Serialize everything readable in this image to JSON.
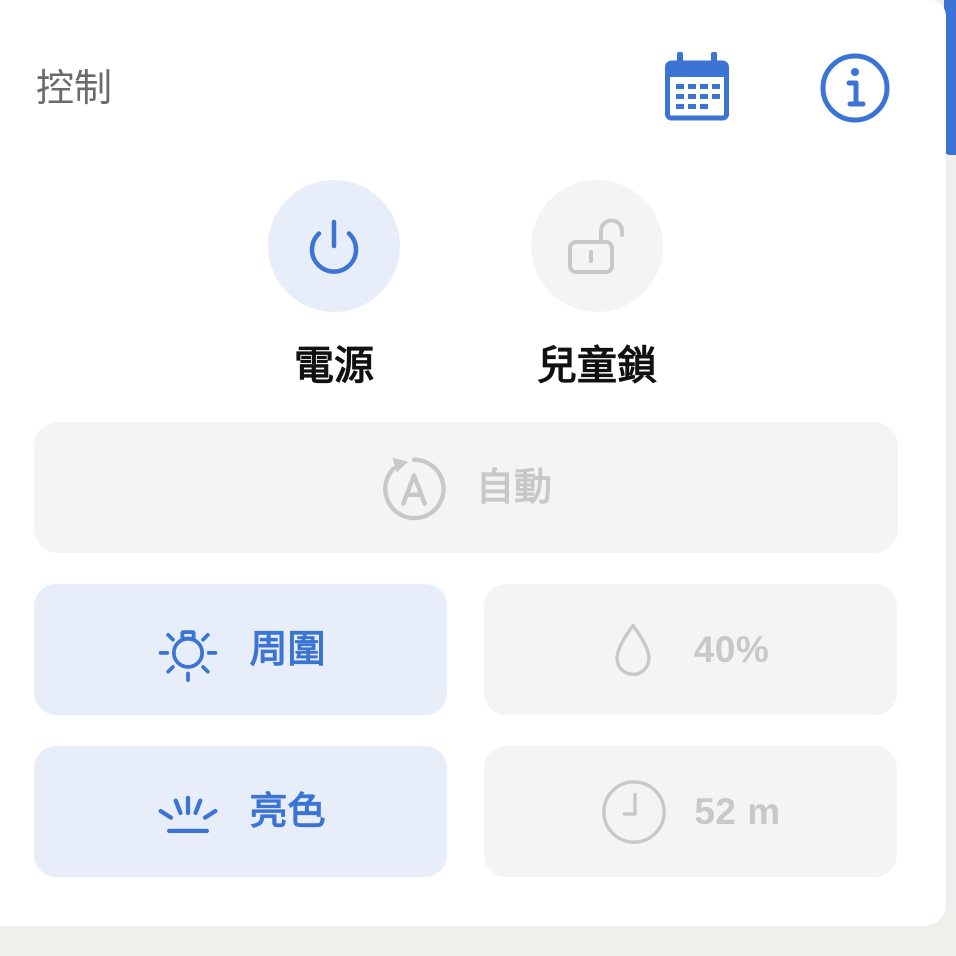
{
  "header": {
    "title": "控制",
    "calendar_icon": "calendar-icon",
    "info_icon": "info-icon"
  },
  "toggles": [
    {
      "label": "電源",
      "icon": "power-icon",
      "active": true
    },
    {
      "label": "兒童鎖",
      "icon": "unlock-icon",
      "active": false
    }
  ],
  "auto_button": {
    "label": "自動",
    "icon": "auto-mode-icon",
    "active": false
  },
  "tiles": {
    "ambient": {
      "label": "周圍",
      "icon": "ambient-light-icon",
      "active": true
    },
    "humidity": {
      "value": "40%",
      "icon": "water-drop-icon",
      "active": false
    },
    "brightness": {
      "label": "亮色",
      "icon": "brightness-icon",
      "active": true
    },
    "timer": {
      "value": "52 m",
      "icon": "clock-icon",
      "active": false
    }
  },
  "colors": {
    "accent": "#3b74d4",
    "active_bg": "#e8eef9",
    "inactive_bg": "#f4f4f4",
    "inactive_fg": "#c8c8c8",
    "title": "#6b6b6b",
    "label": "#111111",
    "page_bg": "#f0efeb"
  }
}
